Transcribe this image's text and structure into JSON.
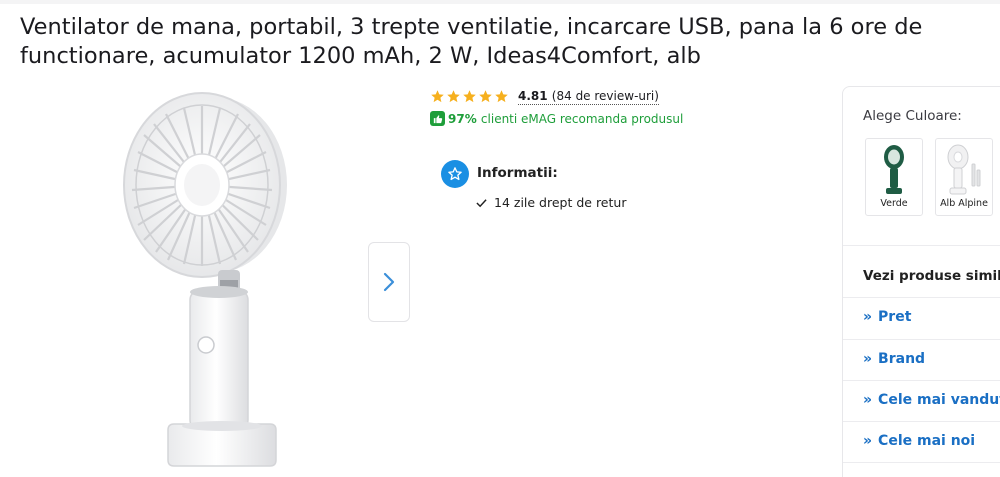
{
  "product": {
    "title": "Ventilator de mana, portabil, 3 trepte ventilatie, incarcare USB, pana la 6 ore de functionare, acumulator 1200 mAh, 2 W, Ideas4Comfort, alb"
  },
  "rating": {
    "stars": 5,
    "score": "4.81",
    "reviews_text": "(84 de review-uri)"
  },
  "recommend": {
    "percent": "97%",
    "text": "clienti eMAG recomanda produsul"
  },
  "info": {
    "title": "Informatii:",
    "items": [
      "14 zile drept de retur"
    ]
  },
  "side": {
    "color_label": "Alege Culoare:",
    "colors": [
      {
        "name": "Verde",
        "hex": "#1f5c44"
      },
      {
        "name": "Alb Alpine",
        "hex": "#f3f3f3"
      }
    ],
    "similar_title": "Vezi produse similare",
    "similar_links": [
      "Pret",
      "Brand",
      "Cele mai vandute",
      "Cele mai noi"
    ]
  },
  "colors": {
    "accent": "#1a8fe3",
    "link": "#1a6fc4",
    "success": "#1e9e3a",
    "star": "#f6b01e"
  },
  "icons": {
    "next": "chevron-right-icon",
    "info": "star-outline-icon",
    "check": "check-icon",
    "thumb": "thumbs-up-icon"
  }
}
